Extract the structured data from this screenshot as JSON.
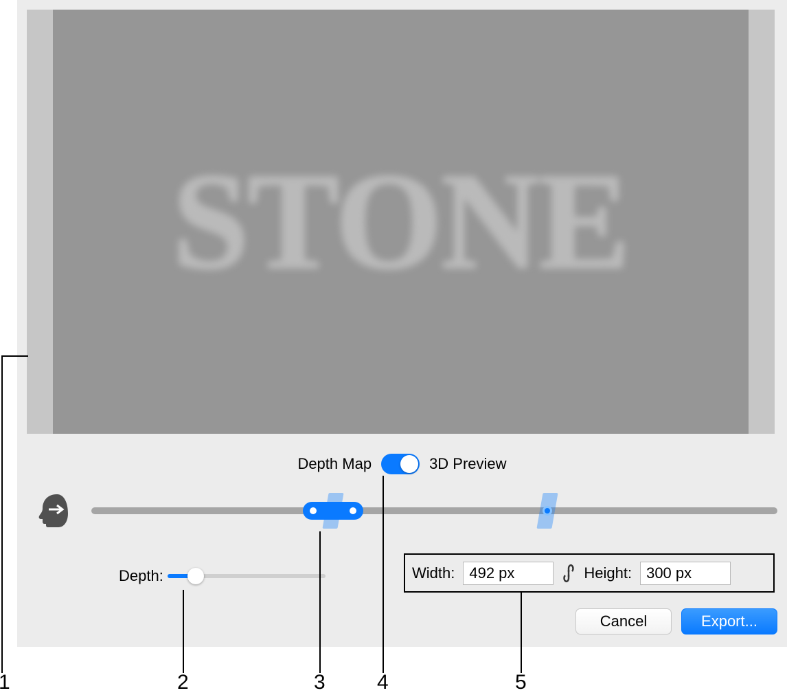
{
  "preview": {
    "display_text": "STONE"
  },
  "toggle": {
    "left_label": "Depth Map",
    "right_label": "3D Preview",
    "state": "on"
  },
  "head_slider": {
    "dual_handle_position_pct": 35.2,
    "marker_position_pct": 66.5
  },
  "depth": {
    "label": "Depth:",
    "value_pct": 18
  },
  "dimensions": {
    "width_label": "Width:",
    "width_value": "492 px",
    "height_label": "Height:",
    "height_value": "300 px"
  },
  "buttons": {
    "cancel": "Cancel",
    "export": "Export..."
  },
  "callouts": {
    "c1": "1",
    "c2": "2",
    "c3": "3",
    "c4": "4",
    "c5": "5"
  }
}
